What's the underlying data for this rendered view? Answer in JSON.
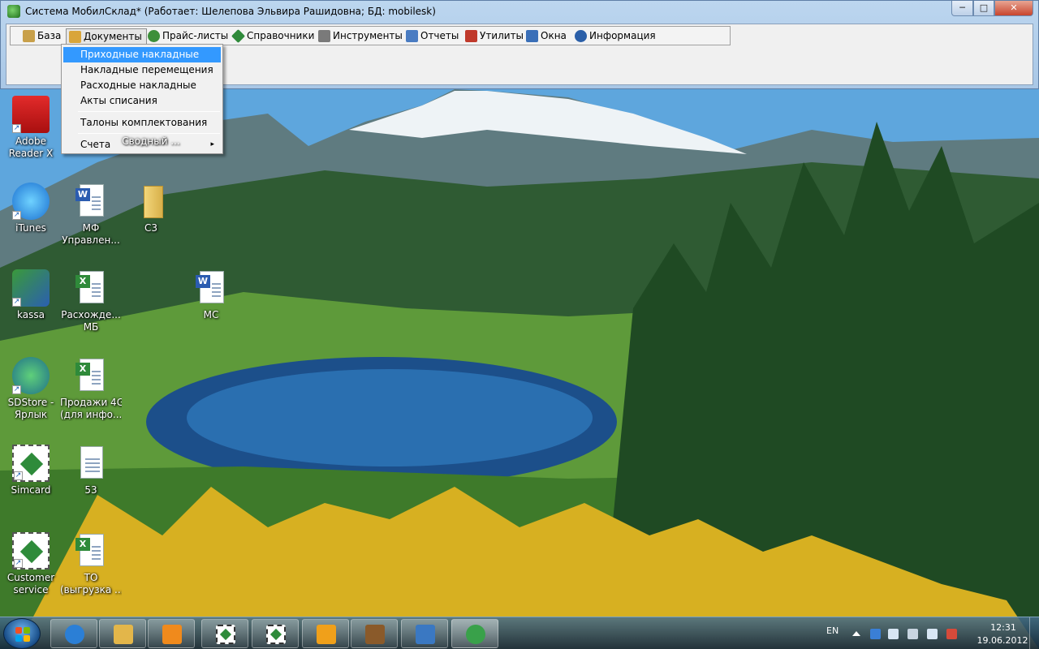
{
  "window": {
    "title": "Система МобилСклад* (Работает: Шелепова Эльвира Рашидовна; БД: mobilesk)",
    "controls": {
      "minimize": "─",
      "maximize": "□",
      "close": "✕"
    }
  },
  "menubar": [
    {
      "label": "База",
      "icon": "database-icon",
      "color": "#c8a04a"
    },
    {
      "label": "Документы",
      "icon": "documents-icon",
      "color": "#d9a53a"
    },
    {
      "label": "Прайс-листы",
      "icon": "price-list-icon",
      "color": "#3d8f3a"
    },
    {
      "label": "Справочники",
      "icon": "reference-book-icon",
      "color": "#2f8a3a"
    },
    {
      "label": "Инструменты",
      "icon": "tools-icon",
      "color": "#7a7a7a"
    },
    {
      "label": "Отчеты",
      "icon": "reports-icon",
      "color": "#4a7cc2"
    },
    {
      "label": "Утилиты",
      "icon": "utilities-icon",
      "color": "#c0392b"
    },
    {
      "label": "Окна",
      "icon": "windows-icon",
      "color": "#3a6fb8"
    },
    {
      "label": "Информация",
      "icon": "info-icon",
      "color": "#2a5fa8"
    }
  ],
  "dropdown": {
    "items": [
      {
        "label": "Приходные накладные",
        "highlighted": true
      },
      {
        "label": "Накладные перемещения"
      },
      {
        "label": "Расходные накладные"
      },
      {
        "label": "Акты списания"
      },
      {
        "label": "Талоны комплектования"
      },
      {
        "label": "Счета",
        "submenu": "▸"
      }
    ]
  },
  "desktop_icons": [
    {
      "label": "Adobe\nReader X",
      "icon": "adobe-reader-icon"
    },
    {
      "label": "Сводный ...",
      "icon": "folder-icon"
    },
    {
      "label": "iTunes",
      "icon": "itunes-icon"
    },
    {
      "label": "МФ\nУправлен...",
      "icon": "word-document-icon"
    },
    {
      "label": "С3",
      "icon": "folder-icon"
    },
    {
      "label": "kassa",
      "icon": "kassa-icon"
    },
    {
      "label": "Расхожде...\nМБ",
      "icon": "excel-document-icon"
    },
    {
      "label": "МС",
      "icon": "word-document-icon"
    },
    {
      "label": "SDStore -\nЯрлык",
      "icon": "sdstore-icon"
    },
    {
      "label": "Продажи 4G\n(для инфо...",
      "icon": "excel-document-icon"
    },
    {
      "label": "Simcard",
      "icon": "simcard-icon"
    },
    {
      "label": "53",
      "icon": "text-document-icon"
    },
    {
      "label": "Customer\nservice",
      "icon": "customer-service-icon"
    },
    {
      "label": "ТО\n(выгрузка ...",
      "icon": "excel-document-icon"
    }
  ],
  "taskbar": {
    "buttons": [
      {
        "icon": "internet-explorer-icon",
        "color": "#2b7fd6"
      },
      {
        "icon": "file-explorer-icon",
        "color": "#e3b64a"
      },
      {
        "icon": "media-player-icon",
        "color": "#f08a1c"
      },
      {
        "icon": "simcard-app-icon",
        "color": "#2e8b3a"
      },
      {
        "icon": "simcard-app-icon",
        "color": "#2e8b3a"
      },
      {
        "icon": "outlook-icon",
        "color": "#f0a01a"
      },
      {
        "icon": "paint-icon",
        "color": "#8a5a2a"
      },
      {
        "icon": "cashbox-icon",
        "color": "#3a78c2"
      },
      {
        "icon": "mobilsklad-icon",
        "color": "#39a14a"
      }
    ],
    "tray": {
      "language": "EN",
      "time": "12:31",
      "date": "19.06.2012"
    }
  }
}
